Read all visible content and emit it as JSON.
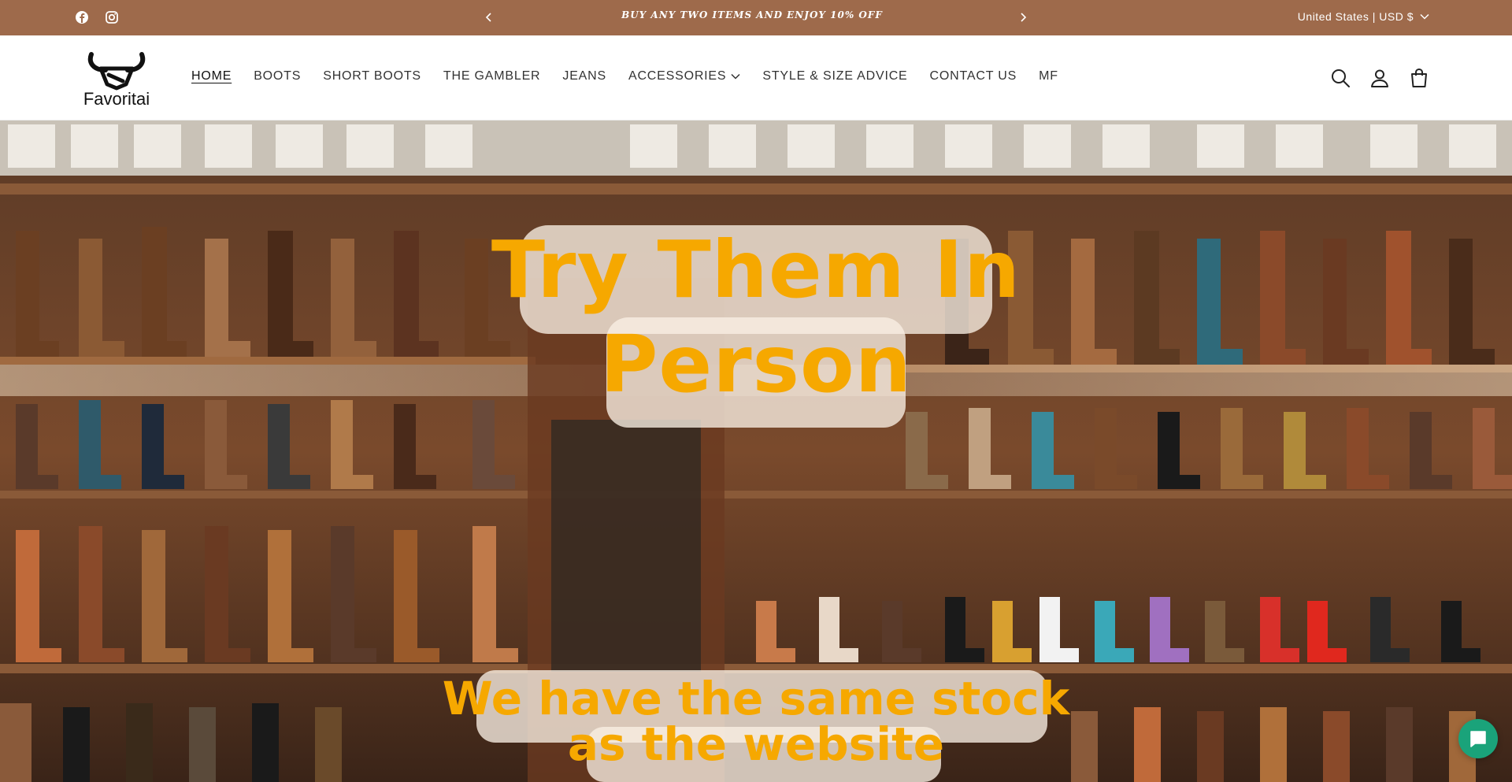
{
  "announcement": {
    "message": "BUY ANY TWO ITEMS AND ENJOY 10% OFF",
    "locale": "United States | USD $"
  },
  "header": {
    "logo_text": "Favoritai",
    "nav": [
      {
        "label": "HOME"
      },
      {
        "label": "BOOTS"
      },
      {
        "label": "SHORT BOOTS"
      },
      {
        "label": "THE GAMBLER"
      },
      {
        "label": "JEANS"
      },
      {
        "label": "ACCESSORIES"
      },
      {
        "label": "STYLE & SIZE ADVICE"
      },
      {
        "label": "CONTACT US"
      },
      {
        "label": "MF"
      }
    ]
  },
  "hero": {
    "headline_line1": "Try Them In",
    "headline_line2": "Person",
    "subline_line1": "We have the same stock",
    "subline_line2": "as the website"
  },
  "colors": {
    "announcement_bg": "#9e6a4b",
    "headline": "#f6a800",
    "chat": "#1aa37a"
  },
  "icons": [
    "facebook-icon",
    "instagram-icon",
    "chevron-left-icon",
    "chevron-right-icon",
    "chevron-down-icon",
    "search-icon",
    "account-icon",
    "cart-icon",
    "chat-icon"
  ]
}
